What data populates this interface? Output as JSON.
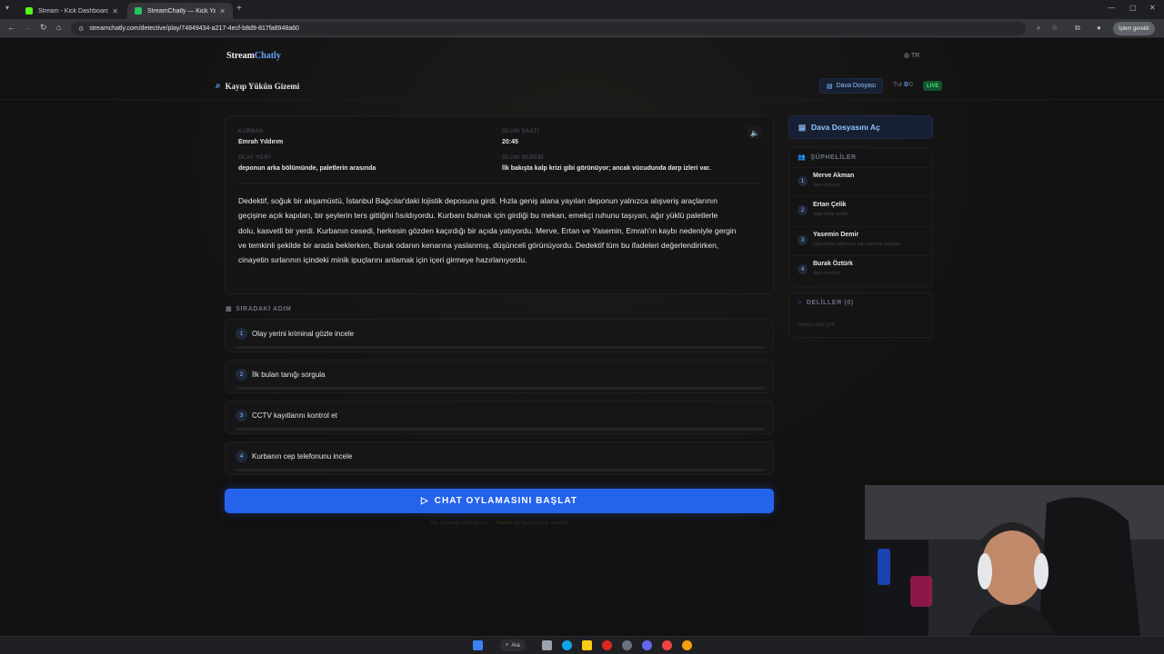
{
  "browser": {
    "tabs": [
      {
        "title": "Stream - Kick Dashboard",
        "favicon_color": "#53fc18"
      },
      {
        "title": "StreamChatly — Kick Yayıncıla",
        "favicon_color": "#22c55e"
      }
    ],
    "url": "streamchatly.com/detective/play/74849434-a217-4ecf-b8d9-817fa8948a60",
    "profile_label": "İşlem gerekli"
  },
  "app": {
    "logo_part1": "Stream",
    "logo_part2": "Chatly",
    "language": "TR",
    "case_title": "Kayıp Yükün Gizemi",
    "dossier_button": "Dava Dosyası",
    "turn_label": "Tur",
    "turn_value": "0",
    "turn_suffix": "/0",
    "live_badge": "LIVE"
  },
  "case": {
    "victim_label": "KURBAN",
    "victim": "Emrah Yıldırım",
    "time_label": "ÖLÜM SAATİ",
    "time": "20:45",
    "location_label": "OLAY YERİ",
    "location": "deponun arka bölümünde, paletlerin arasında",
    "cause_label": "ÖLÜM SEBEBİ",
    "cause": "İlk bakışta kalp krizi gibi görünüyor; ancak vücudunda darp izleri var.",
    "story": "Dedektif, soğuk bir akşamüstü, İstanbul Bağcılar'daki lojistik deposuna girdi. Hızla geniş alana yayılan deponun yalnızca alışveriş araçlarının geçişine açık kapıları, bir şeylerin ters gittiğini fısıldıyordu. Kurbanı bulmak için girdiği bu mekan, emekçi ruhunu taşıyan, ağır yüklü paletlerle dolu, kasvetli bir yerdi. Kurbanın cesedi, herkesin gözden kaçırdığı bir açıda yatıyordu. Merve, Ertan ve Yasemin, Emrah'ın kaybı nedeniyle gergin ve temkinli şekilde bir arada beklerken, Burak odanın kenarına yaslanmış, düşünceli görünüyordu. Dedektif tüm bu ifadeleri değerlendirirken, cinayetin sırlarının içindeki minik ipuçlarını anlamak için içeri girmeye hazırlanıyordu."
  },
  "next_step": {
    "label": "SIRADAKİ ADIM",
    "options": [
      {
        "num": "1",
        "label": "Olay yerini kriminal gözle incele",
        "progress": 0
      },
      {
        "num": "2",
        "label": "İlk bulan tanığı sorgula",
        "progress": 0
      },
      {
        "num": "3",
        "label": "CCTV kayıtlarını kontrol et",
        "progress": 0
      },
      {
        "num": "4",
        "label": "Kurbanın cep telefonunu incele",
        "progress": 0
      }
    ],
    "vote_button": "CHAT OYLAMASINI BAŞLAT",
    "hint_prefix": "Her seçeneği izleyiciler oy — ",
    "hint_highlight": "Yayıncı",
    "hint_suffix": " tek başına karar verebilir"
  },
  "sidebar": {
    "open_dossier": "Dava Dosyasını Aç",
    "suspects_title": "ŞÜPHELİLER",
    "suspects": [
      {
        "num": "1",
        "name": "Merve Akman",
        "role": "depo çalışanı"
      },
      {
        "num": "2",
        "name": "Ertan Çelik",
        "role": "rakip firma sahibi"
      },
      {
        "num": "3",
        "name": "Yasemin Demir",
        "role": "yüksekokul öğrencisi, yarı zamanlı çalışıyor"
      },
      {
        "num": "4",
        "name": "Burak Öztürk",
        "role": "depo müdürü"
      }
    ],
    "evidence_title": "DELİLLER (0)",
    "no_evidence": "Henüz delil yok"
  },
  "taskbar": {
    "search_label": "Ara"
  },
  "colors": {
    "accent": "#2563eb",
    "accent_light": "#93c5fd",
    "live_green": "#4ade80",
    "background": "#111112"
  }
}
